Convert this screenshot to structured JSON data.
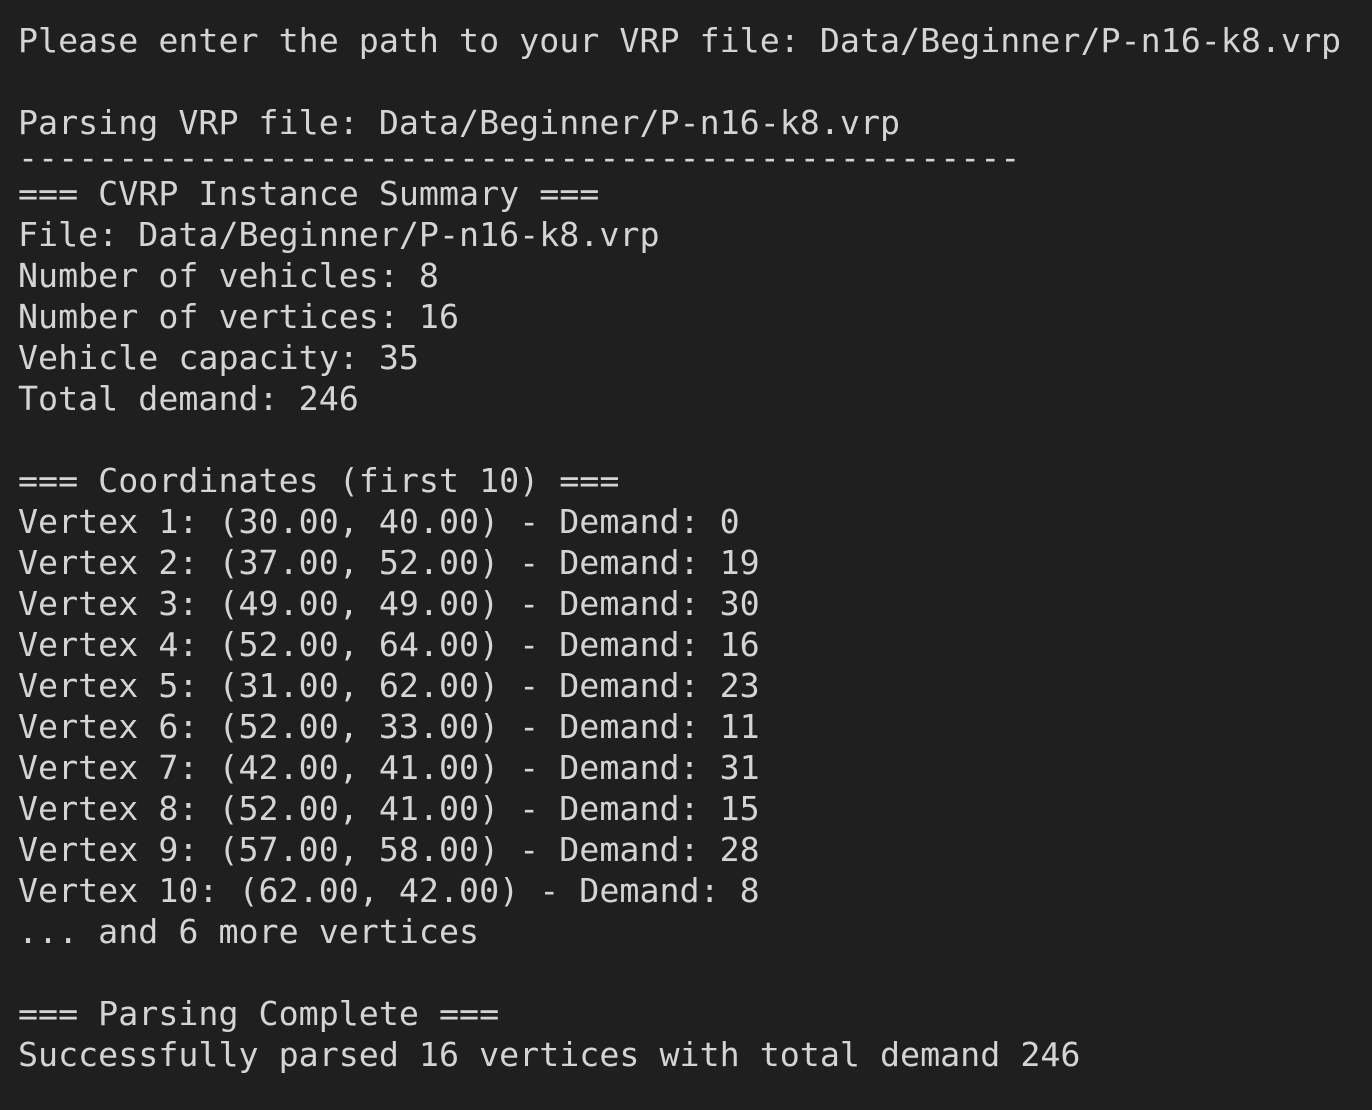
{
  "terminal": {
    "prompt": "Please enter the path to your VRP file: Data/Beginner/P-n16-k8.vrp",
    "parsing": "Parsing VRP file: Data/Beginner/P-n16-k8.vrp",
    "separator": "--------------------------------------------------",
    "summary_header": "=== CVRP Instance Summary ===",
    "file": "File: Data/Beginner/P-n16-k8.vrp",
    "vehicles": "Number of vehicles: 8",
    "vertices_count": "Number of vertices: 16",
    "capacity": "Vehicle capacity: 35",
    "total_demand": "Total demand: 246",
    "coords_header": "=== Coordinates (first 10) ===",
    "vertices": [
      "Vertex 1: (30.00, 40.00) - Demand: 0",
      "Vertex 2: (37.00, 52.00) - Demand: 19",
      "Vertex 3: (49.00, 49.00) - Demand: 30",
      "Vertex 4: (52.00, 64.00) - Demand: 16",
      "Vertex 5: (31.00, 62.00) - Demand: 23",
      "Vertex 6: (52.00, 33.00) - Demand: 11",
      "Vertex 7: (42.00, 41.00) - Demand: 31",
      "Vertex 8: (52.00, 41.00) - Demand: 15",
      "Vertex 9: (57.00, 58.00) - Demand: 28",
      "Vertex 10: (62.00, 42.00) - Demand: 8"
    ],
    "more": "... and 6 more vertices",
    "complete_header": "=== Parsing Complete ===",
    "success": "Successfully parsed 16 vertices with total demand 246"
  }
}
